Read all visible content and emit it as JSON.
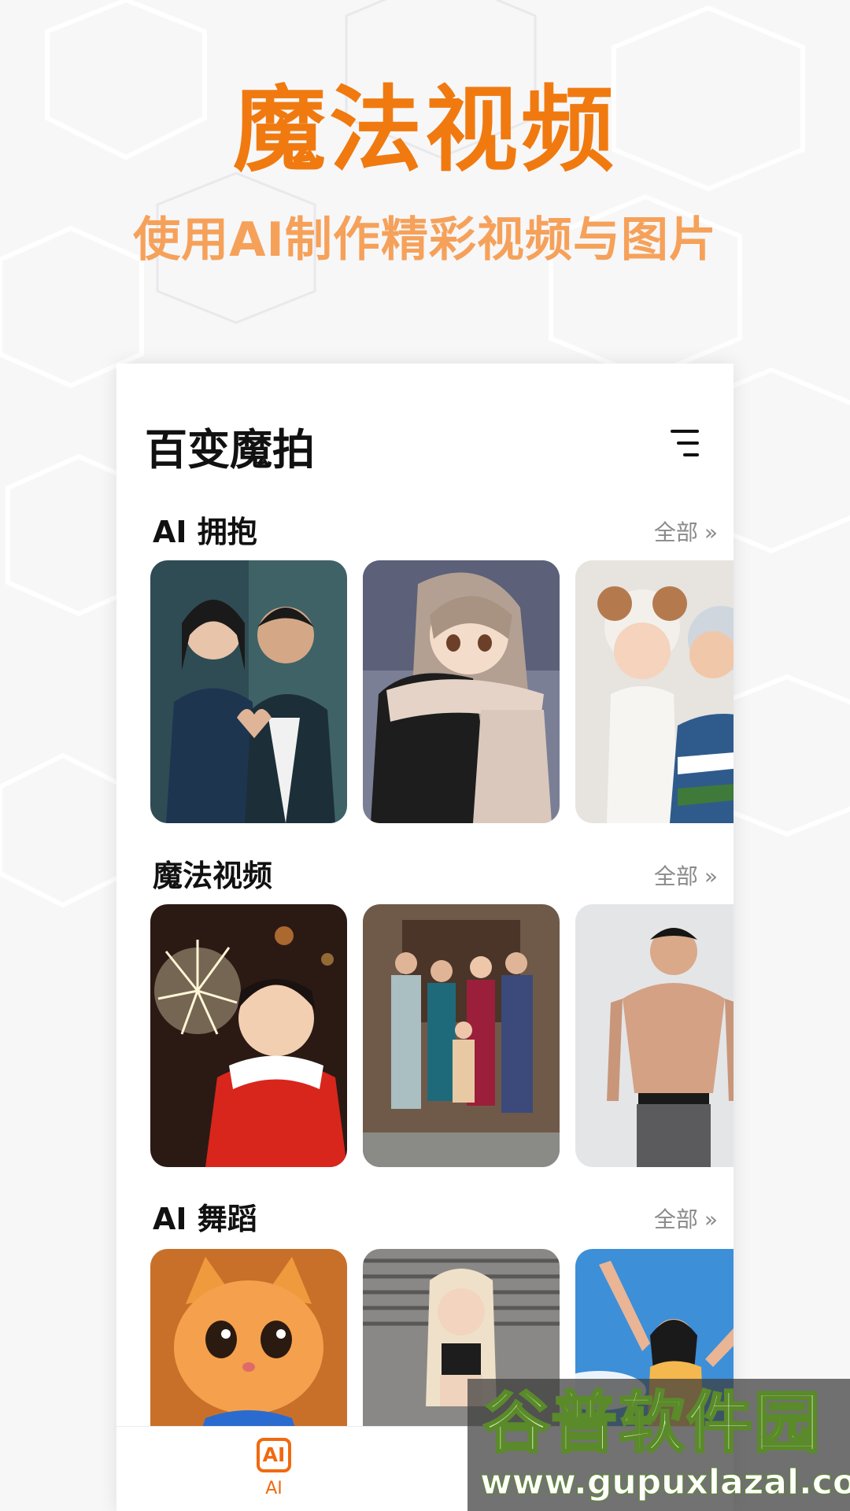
{
  "promo": {
    "title": "魔法视频",
    "subtitle": "使用AI制作精彩视频与图片"
  },
  "app": {
    "title": "百变魔拍",
    "menu_icon": "menu-lines-icon"
  },
  "sections": [
    {
      "title": "AI 拥抱",
      "see_all": "全部",
      "see_all_icon": "double-chevron-right-icon",
      "cards": [
        {
          "image": "couple-heart-hands"
        },
        {
          "image": "anime-hug"
        },
        {
          "image": "baby-and-grandma"
        }
      ]
    },
    {
      "title": "魔法视频",
      "see_all": "全部",
      "see_all_icon": "double-chevron-right-icon",
      "cards": [
        {
          "image": "girl-with-sparkler"
        },
        {
          "image": "family-portrait"
        },
        {
          "image": "muscular-man"
        }
      ]
    },
    {
      "title": "AI 舞蹈",
      "see_all": "全部",
      "see_all_icon": "double-chevron-right-icon",
      "cards": [
        {
          "image": "orange-kitten"
        },
        {
          "image": "blonde-dancer"
        },
        {
          "image": "woman-blue-sky"
        }
      ]
    }
  ],
  "tabbar": {
    "ai_icon_text": "AI",
    "ai_label": "AI"
  },
  "watermark": {
    "name": "谷普软件园",
    "url": "www.gupuxlazal.com"
  },
  "colors": {
    "accent": "#f07a10",
    "subtitle": "#f6a15a",
    "tab_active": "#f06a10"
  }
}
